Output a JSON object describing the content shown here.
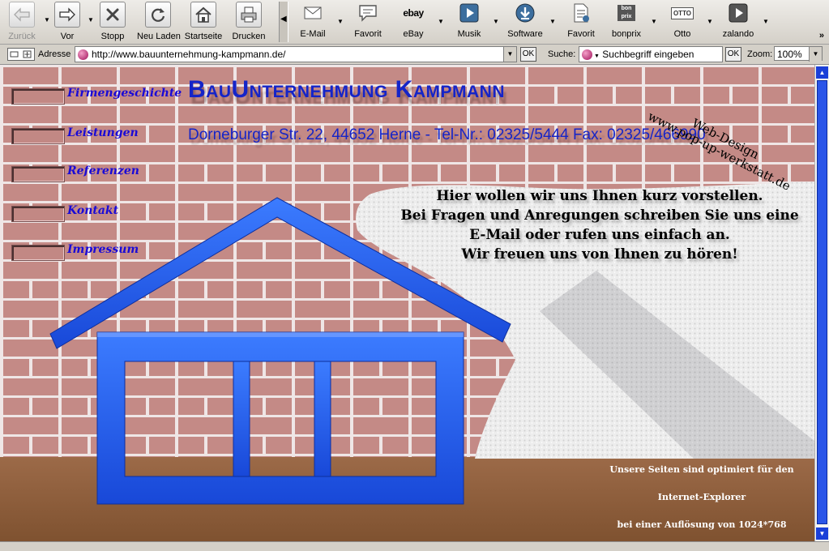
{
  "toolbar": {
    "nav": [
      {
        "label": "Zurück",
        "icon": "back-arrow-icon",
        "enabled": false
      },
      {
        "label": "Vor",
        "icon": "forward-arrow-icon",
        "enabled": true
      },
      {
        "label": "Stopp",
        "icon": "stop-icon",
        "enabled": true
      },
      {
        "label": "Neu Laden",
        "icon": "reload-icon",
        "enabled": true
      },
      {
        "label": "Startseite",
        "icon": "home-icon",
        "enabled": true
      },
      {
        "label": "Drucken",
        "icon": "printer-icon",
        "enabled": true
      }
    ],
    "favorites": [
      {
        "label": "E-Mail",
        "icon": "envelope-icon"
      },
      {
        "label": "Favorit",
        "icon": "speech-bubble-icon"
      },
      {
        "label": "eBay",
        "icon": "ebay-logo-icon",
        "logo_text": "ebay"
      },
      {
        "label": "Musik",
        "icon": "play-icon"
      },
      {
        "label": "Software",
        "icon": "download-icon"
      },
      {
        "label": "Favorit",
        "icon": "document-icon"
      },
      {
        "label": "bonprix",
        "icon": "bonprix-logo-icon",
        "logo_text": "bon prix"
      },
      {
        "label": "Otto",
        "icon": "otto-logo-icon",
        "logo_text": "OTTO"
      },
      {
        "label": "zalando",
        "icon": "play-icon"
      }
    ],
    "more": "»"
  },
  "addressbar": {
    "label": "Adresse",
    "url": "http://www.bauunternehmung-kampmann.de/",
    "ok": "OK",
    "search_label": "Suche:",
    "search_placeholder": "Suchbegriff eingeben",
    "search_ok": "OK",
    "zoom_label": "Zoom:",
    "zoom_value": "100%"
  },
  "site": {
    "title": "BauUnternehmung Kampmann",
    "address": "Dorneburger Str. 22, 44652 Herne - Tel-Nr.: 02325/5444 Fax: 02325/466990",
    "webdesign_line1": "Web-Design",
    "webdesign_line2": "www.pop-up-werkstatt.de",
    "menu": [
      "Firmengeschichte",
      "Leistungen",
      "Referenzen",
      "Kontakt",
      "Impressum"
    ],
    "intro": [
      "Hier wollen wir uns Ihnen kurz vorstellen.",
      "Bei Fragen und Anregungen schreiben Sie uns eine",
      "E-Mail oder rufen uns einfach an.",
      "Wir freuen uns von Ihnen zu hören!"
    ],
    "footer": [
      "Unsere Seiten sind optimiert für den",
      "Internet-Explorer",
      "bei einer Auflösung von 1024*768"
    ],
    "colors": {
      "link": "#1a0ad6",
      "title": "#1524c8",
      "house": "#1f5fef",
      "brick": "#c48a86",
      "floor": "#8a5a38"
    }
  }
}
